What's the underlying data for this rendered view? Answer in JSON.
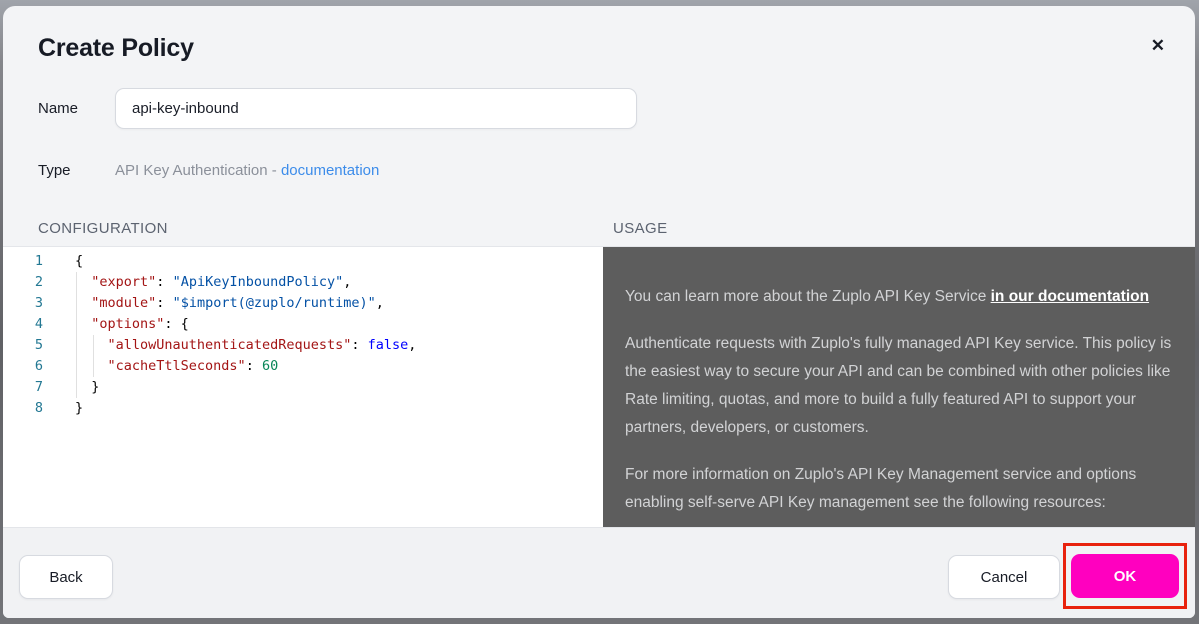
{
  "dialog": {
    "title": "Create Policy",
    "close_icon": "✕"
  },
  "form": {
    "name_label": "Name",
    "name_value": "api-key-inbound",
    "type_label": "Type",
    "type_value": "API Key Authentication - ",
    "type_link": "documentation"
  },
  "sections": {
    "configuration_label": "CONFIGURATION",
    "usage_label": "USAGE"
  },
  "code": {
    "colors": {
      "key": "#a31515",
      "str": "#0451a5",
      "kw": "#0000ff",
      "num": "#098658",
      "pun": "#000000",
      "line_number": "#237893"
    },
    "lines": [
      {
        "num": "1",
        "segments": [
          {
            "text": "{",
            "style": "pun"
          }
        ]
      },
      {
        "num": "2",
        "segments": [
          {
            "text": "  ",
            "style": "pun"
          },
          {
            "text": "\"export\"",
            "style": "key"
          },
          {
            "text": ": ",
            "style": "pun"
          },
          {
            "text": "\"ApiKeyInboundPolicy\"",
            "style": "str"
          },
          {
            "text": ",",
            "style": "pun"
          }
        ]
      },
      {
        "num": "3",
        "segments": [
          {
            "text": "  ",
            "style": "pun"
          },
          {
            "text": "\"module\"",
            "style": "key"
          },
          {
            "text": ": ",
            "style": "pun"
          },
          {
            "text": "\"$import(@zuplo/runtime)\"",
            "style": "str"
          },
          {
            "text": ",",
            "style": "pun"
          }
        ]
      },
      {
        "num": "4",
        "segments": [
          {
            "text": "  ",
            "style": "pun"
          },
          {
            "text": "\"options\"",
            "style": "key"
          },
          {
            "text": ": {",
            "style": "pun"
          }
        ]
      },
      {
        "num": "5",
        "segments": [
          {
            "text": "    ",
            "style": "pun"
          },
          {
            "text": "\"allowUnauthenticatedRequests\"",
            "style": "key"
          },
          {
            "text": ": ",
            "style": "pun"
          },
          {
            "text": "false",
            "style": "kw"
          },
          {
            "text": ",",
            "style": "pun"
          }
        ]
      },
      {
        "num": "6",
        "segments": [
          {
            "text": "    ",
            "style": "pun"
          },
          {
            "text": "\"cacheTtlSeconds\"",
            "style": "key"
          },
          {
            "text": ": ",
            "style": "pun"
          },
          {
            "text": "60",
            "style": "num"
          }
        ]
      },
      {
        "num": "7",
        "segments": [
          {
            "text": "  }",
            "style": "pun"
          }
        ]
      },
      {
        "num": "8",
        "segments": [
          {
            "text": "}",
            "style": "pun"
          }
        ]
      }
    ]
  },
  "usage": {
    "p1_text": "You can learn more about the Zuplo API Key Service ",
    "p1_link": "in our documentation",
    "p2": "Authenticate requests with Zuplo's fully managed API Key service. This policy is the easiest way to secure your API and can be combined with other policies like Rate limiting, quotas, and more to build a fully featured API to support your partners, developers, or customers.",
    "p3": "For more information on Zuplo's API Key Management service and options enabling self-serve API Key management see the following resources:"
  },
  "footer": {
    "back_label": "Back",
    "cancel_label": "Cancel",
    "ok_label": "OK"
  },
  "colors": {
    "accent_magenta": "#ff00bf",
    "annotation_red": "#e8220d",
    "link_blue": "#3c8cea",
    "usage_bg": "#5d5d5d",
    "usage_text": "#d2d3d5",
    "usage_link_white": "#ffffff"
  }
}
